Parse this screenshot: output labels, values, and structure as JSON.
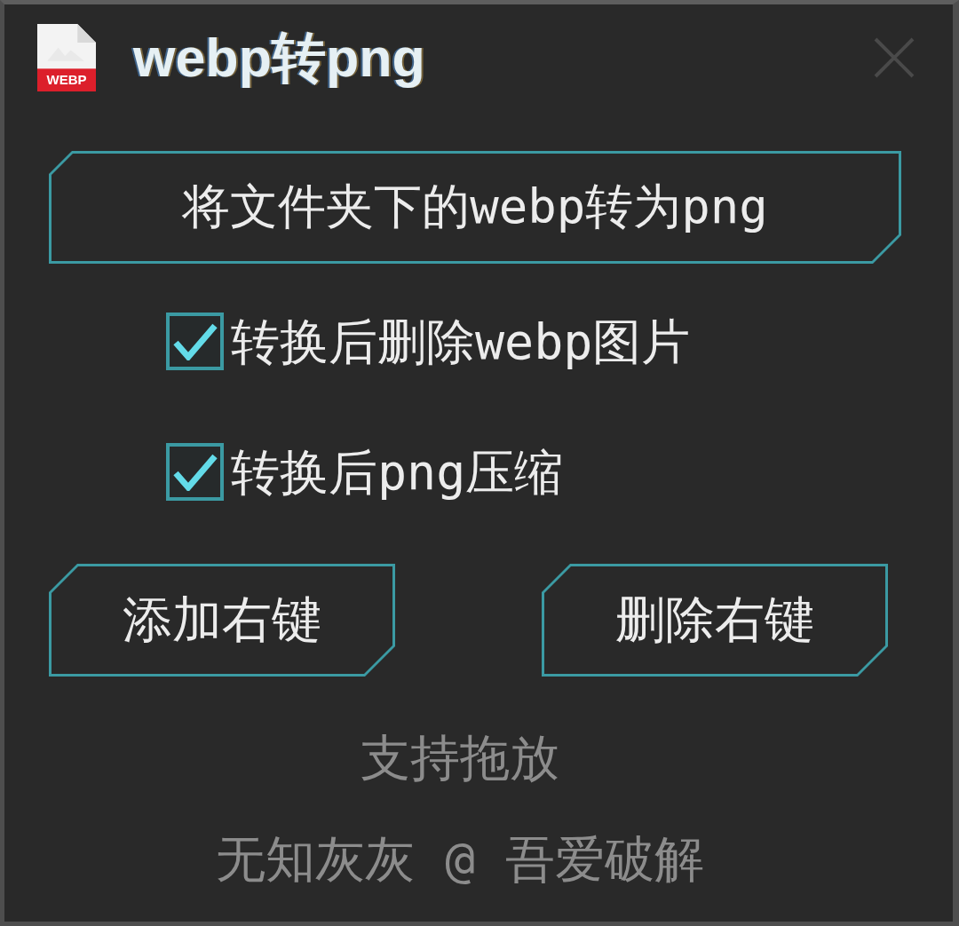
{
  "window": {
    "title": "webp转png",
    "icon_label": "WEBP"
  },
  "convert_button": {
    "label": "将文件夹下的webp转为png"
  },
  "options": [
    {
      "label": "转换后删除webp图片",
      "checked": true
    },
    {
      "label": "转换后png压缩",
      "checked": true
    }
  ],
  "context_menu_buttons": [
    {
      "label": "添加右键"
    },
    {
      "label": "删除右键"
    }
  ],
  "hint": "支持拖放",
  "credit": "无知灰灰 @ 吾爱破解"
}
